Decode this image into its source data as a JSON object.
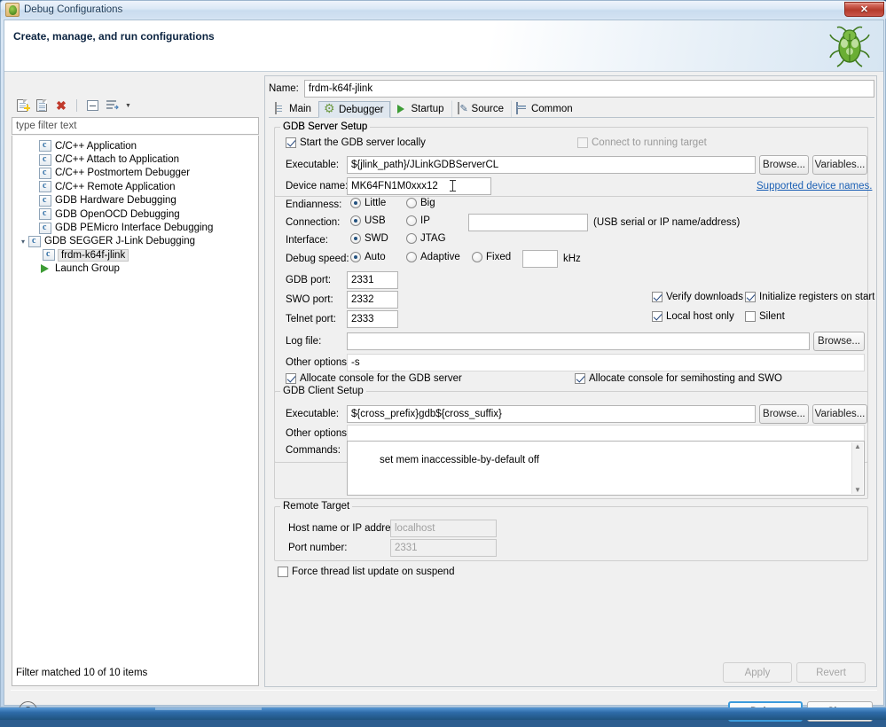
{
  "window": {
    "title": "Debug Configurations",
    "ghost_title": "",
    "close_label": "✕",
    "icon": "bug-icon"
  },
  "header": {
    "title": "Create, manage, and run configurations",
    "icon": "green-bug-icon"
  },
  "tree_toolbar": {
    "items": [
      {
        "name": "new-configuration-icon",
        "label": ""
      },
      {
        "name": "duplicate-configuration-icon",
        "label": ""
      },
      {
        "name": "delete-configuration-icon",
        "label": ""
      },
      {
        "name": "collapse-all-icon",
        "label": ""
      },
      {
        "name": "filter-icon",
        "label": ""
      },
      {
        "name": "view-menu-chevron-icon",
        "label": ""
      }
    ]
  },
  "filter": {
    "placeholder": "type filter text",
    "value": "type filter text",
    "status": "Filter matched 10 of 10 items"
  },
  "tree": {
    "items": [
      {
        "label": "C/C++ Application",
        "icon": "c-file-icon",
        "indent": 1,
        "expander": "",
        "selected": false
      },
      {
        "label": "C/C++ Attach to Application",
        "icon": "c-file-icon",
        "indent": 1,
        "expander": "",
        "selected": false
      },
      {
        "label": "C/C++ Postmortem Debugger",
        "icon": "c-file-icon",
        "indent": 1,
        "expander": "",
        "selected": false
      },
      {
        "label": "C/C++ Remote Application",
        "icon": "c-file-icon",
        "indent": 1,
        "expander": "",
        "selected": false
      },
      {
        "label": "GDB Hardware Debugging",
        "icon": "c-file-icon",
        "indent": 1,
        "expander": "",
        "selected": false
      },
      {
        "label": "GDB OpenOCD Debugging",
        "icon": "c-file-icon",
        "indent": 1,
        "expander": "",
        "selected": false
      },
      {
        "label": "GDB PEMicro Interface Debugging",
        "icon": "c-file-icon",
        "indent": 1,
        "expander": "",
        "selected": false
      },
      {
        "label": "GDB SEGGER J-Link Debugging",
        "icon": "c-file-icon",
        "indent": 0,
        "expander": "▾",
        "selected": false
      },
      {
        "label": "frdm-k64f-jlink",
        "icon": "c-file-icon",
        "indent": 2,
        "expander": "",
        "selected": true
      },
      {
        "label": "Launch Group",
        "icon": "play-icon",
        "indent": 1,
        "expander": "",
        "selected": false
      }
    ]
  },
  "config": {
    "name_label": "Name:",
    "name_value": "frdm-k64f-jlink"
  },
  "tabs": [
    {
      "label": "Main",
      "icon": "document-icon",
      "active": false
    },
    {
      "label": "Debugger",
      "icon": "gear-icon",
      "active": true
    },
    {
      "label": "Startup",
      "icon": "play-icon",
      "active": false
    },
    {
      "label": "Source",
      "icon": "source-icon",
      "active": false
    },
    {
      "label": "Common",
      "icon": "table-icon",
      "active": false
    }
  ],
  "gdb_server": {
    "legend": "GDB Server Setup",
    "start_locally": {
      "label": "Start the GDB server locally",
      "checked": true,
      "enabled": true
    },
    "connect_running": {
      "label": "Connect to running target",
      "checked": false,
      "enabled": false
    },
    "executable_label": "Executable:",
    "executable_value": "${jlink_path}/JLinkGDBServerCL",
    "browse_label": "Browse...",
    "variables_label": "Variables...",
    "device_label": "Device name:",
    "device_value": "MK64FN1M0xxx12",
    "supported_link": "Supported device names.",
    "endianness_label": "Endianness:",
    "endianness_options": [
      {
        "label": "Little",
        "selected": true
      },
      {
        "label": "Big",
        "selected": false
      }
    ],
    "connection_label": "Connection:",
    "connection_options": [
      {
        "label": "USB",
        "selected": true
      },
      {
        "label": "IP",
        "selected": false
      }
    ],
    "connection_value": "",
    "connection_hint": "(USB serial or IP name/address)",
    "interface_label": "Interface:",
    "interface_options": [
      {
        "label": "SWD",
        "selected": true
      },
      {
        "label": "JTAG",
        "selected": false
      }
    ],
    "speed_label": "Debug speed:",
    "speed_options": [
      {
        "label": "Auto",
        "selected": true
      },
      {
        "label": "Adaptive",
        "selected": false
      },
      {
        "label": "Fixed",
        "selected": false
      }
    ],
    "speed_value": "",
    "speed_unit": "kHz",
    "gdb_port_label": "GDB port:",
    "gdb_port_value": "2331",
    "swo_port_label": "SWO port:",
    "swo_port_value": "2332",
    "telnet_port_label": "Telnet port:",
    "telnet_port_value": "2333",
    "verify_downloads": {
      "label": "Verify downloads",
      "checked": true
    },
    "init_registers": {
      "label": "Initialize registers on start",
      "checked": true
    },
    "local_host_only": {
      "label": "Local host only",
      "checked": true
    },
    "silent": {
      "label": "Silent",
      "checked": false
    },
    "log_file_label": "Log file:",
    "log_file_value": "",
    "log_browse_label": "Browse...",
    "other_options_label": "Other options:",
    "other_options_value": "-s",
    "alloc_server": {
      "label": "Allocate console for the GDB server",
      "checked": true
    },
    "alloc_semi": {
      "label": "Allocate console for semihosting and SWO",
      "checked": true
    }
  },
  "gdb_client": {
    "legend": "GDB Client Setup",
    "executable_label": "Executable:",
    "executable_value": "${cross_prefix}gdb${cross_suffix}",
    "browse_label": "Browse...",
    "variables_label": "Variables...",
    "other_options_label": "Other options:",
    "other_options_value": "",
    "commands_label": "Commands:",
    "commands_value": "set mem inaccessible-by-default off"
  },
  "remote_target": {
    "legend": "Remote Target",
    "host_label": "Host name or IP address:",
    "host_value": "localhost",
    "port_label": "Port number:",
    "port_value": "2331"
  },
  "force_thread": {
    "label": "Force thread list update on suspend",
    "checked": false
  },
  "footer": {
    "apply_label": "Apply",
    "revert_label": "Revert",
    "debug_label": "Debug",
    "close_label": "Close",
    "help_label": "?"
  },
  "colors": {
    "accent": "#3c9bdc",
    "link": "#1a5fb4",
    "titlebar": "#cadcef",
    "close_red": "#b43b2c",
    "panel_bg": "#f0f0f0",
    "tab_active_bg": "#dfe7ef"
  }
}
